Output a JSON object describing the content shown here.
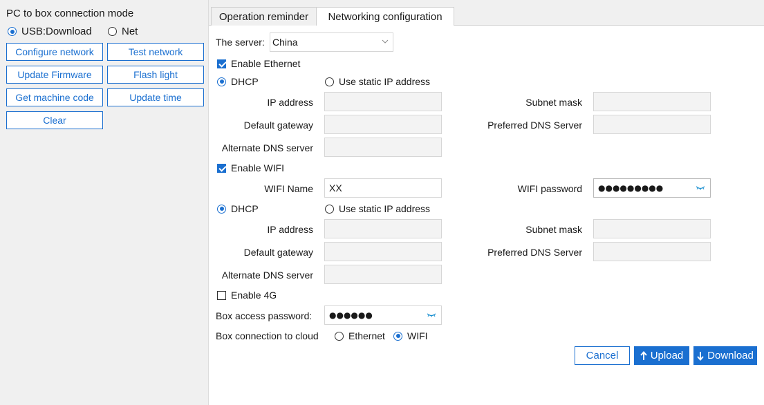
{
  "left": {
    "title": "PC to box connection mode",
    "mode_options": [
      "USB:Download",
      "Net"
    ],
    "mode_selected": "USB:Download",
    "buttons": {
      "configure_network": "Configure network",
      "test_network": "Test network",
      "update_firmware": "Update Firmware",
      "flash_light": "Flash light",
      "get_machine_code": "Get machine code",
      "update_time": "Update time",
      "clear": "Clear"
    }
  },
  "tabs": [
    {
      "label": "Operation reminder",
      "active": false
    },
    {
      "label": "Networking configuration",
      "active": true
    }
  ],
  "config": {
    "server_label": "The server:",
    "server_value": "China",
    "ethernet": {
      "enable_label": "Enable Ethernet",
      "enabled": true,
      "dhcp_label": "DHCP",
      "static_label": "Use static IP address",
      "mode": "DHCP",
      "ip_label": "IP address",
      "subnet_label": "Subnet mask",
      "gateway_label": "Default gateway",
      "pref_dns_label": "Preferred DNS Server",
      "alt_dns_label": "Alternate DNS server",
      "ip": "",
      "subnet": "",
      "gateway": "",
      "pref_dns": "",
      "alt_dns": ""
    },
    "wifi": {
      "enable_label": "Enable WIFI",
      "enabled": true,
      "name_label": "WIFI Name",
      "name_value": "XX",
      "password_label": "WIFI password",
      "password_mask": "●●●●●●●●●",
      "dhcp_label": "DHCP",
      "static_label": "Use static IP address",
      "mode": "DHCP",
      "ip_label": "IP address",
      "subnet_label": "Subnet mask",
      "gateway_label": "Default gateway",
      "pref_dns_label": "Preferred DNS Server",
      "alt_dns_label": "Alternate DNS server"
    },
    "g4": {
      "enable_label": "Enable 4G",
      "enabled": false
    },
    "box_password_label": "Box access password:",
    "box_password_mask": "●●●●●●",
    "cloud_label": "Box connection to cloud",
    "cloud_options": [
      "Ethernet",
      "WIFI"
    ],
    "cloud_selected": "WIFI"
  },
  "actions": {
    "cancel": "Cancel",
    "upload": "Upload",
    "download": "Download"
  },
  "colors": {
    "accent": "#1a6fd0",
    "field_bg": "#f3f3f3"
  },
  "icons": {
    "eye": "eye-closed-icon",
    "upload": "arrow-up-icon",
    "download": "arrow-down-icon",
    "dropdown": "chevron-down-icon"
  }
}
